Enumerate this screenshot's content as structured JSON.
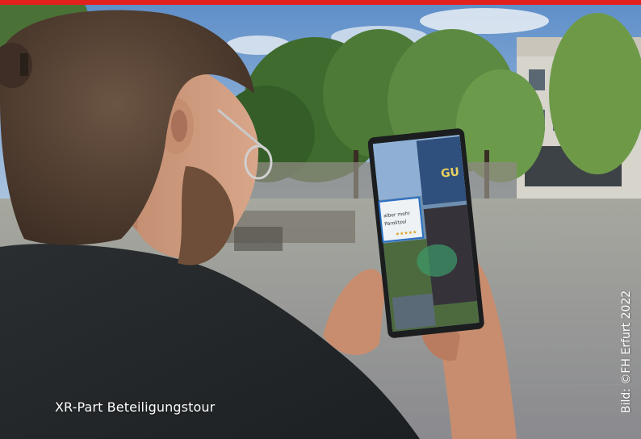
{
  "caption": "XR-Part Beteiligungstour",
  "credit": "Bild: ©FH Erfurt 2022",
  "tablet_screen": {
    "label_line1": "alber mehr",
    "label_line2": "Parolitzel",
    "rating_stars": "★★★★★",
    "sign_text": "GU"
  },
  "colors": {
    "accent_bar": "#e2201d",
    "caption_text": "#ffffff"
  }
}
